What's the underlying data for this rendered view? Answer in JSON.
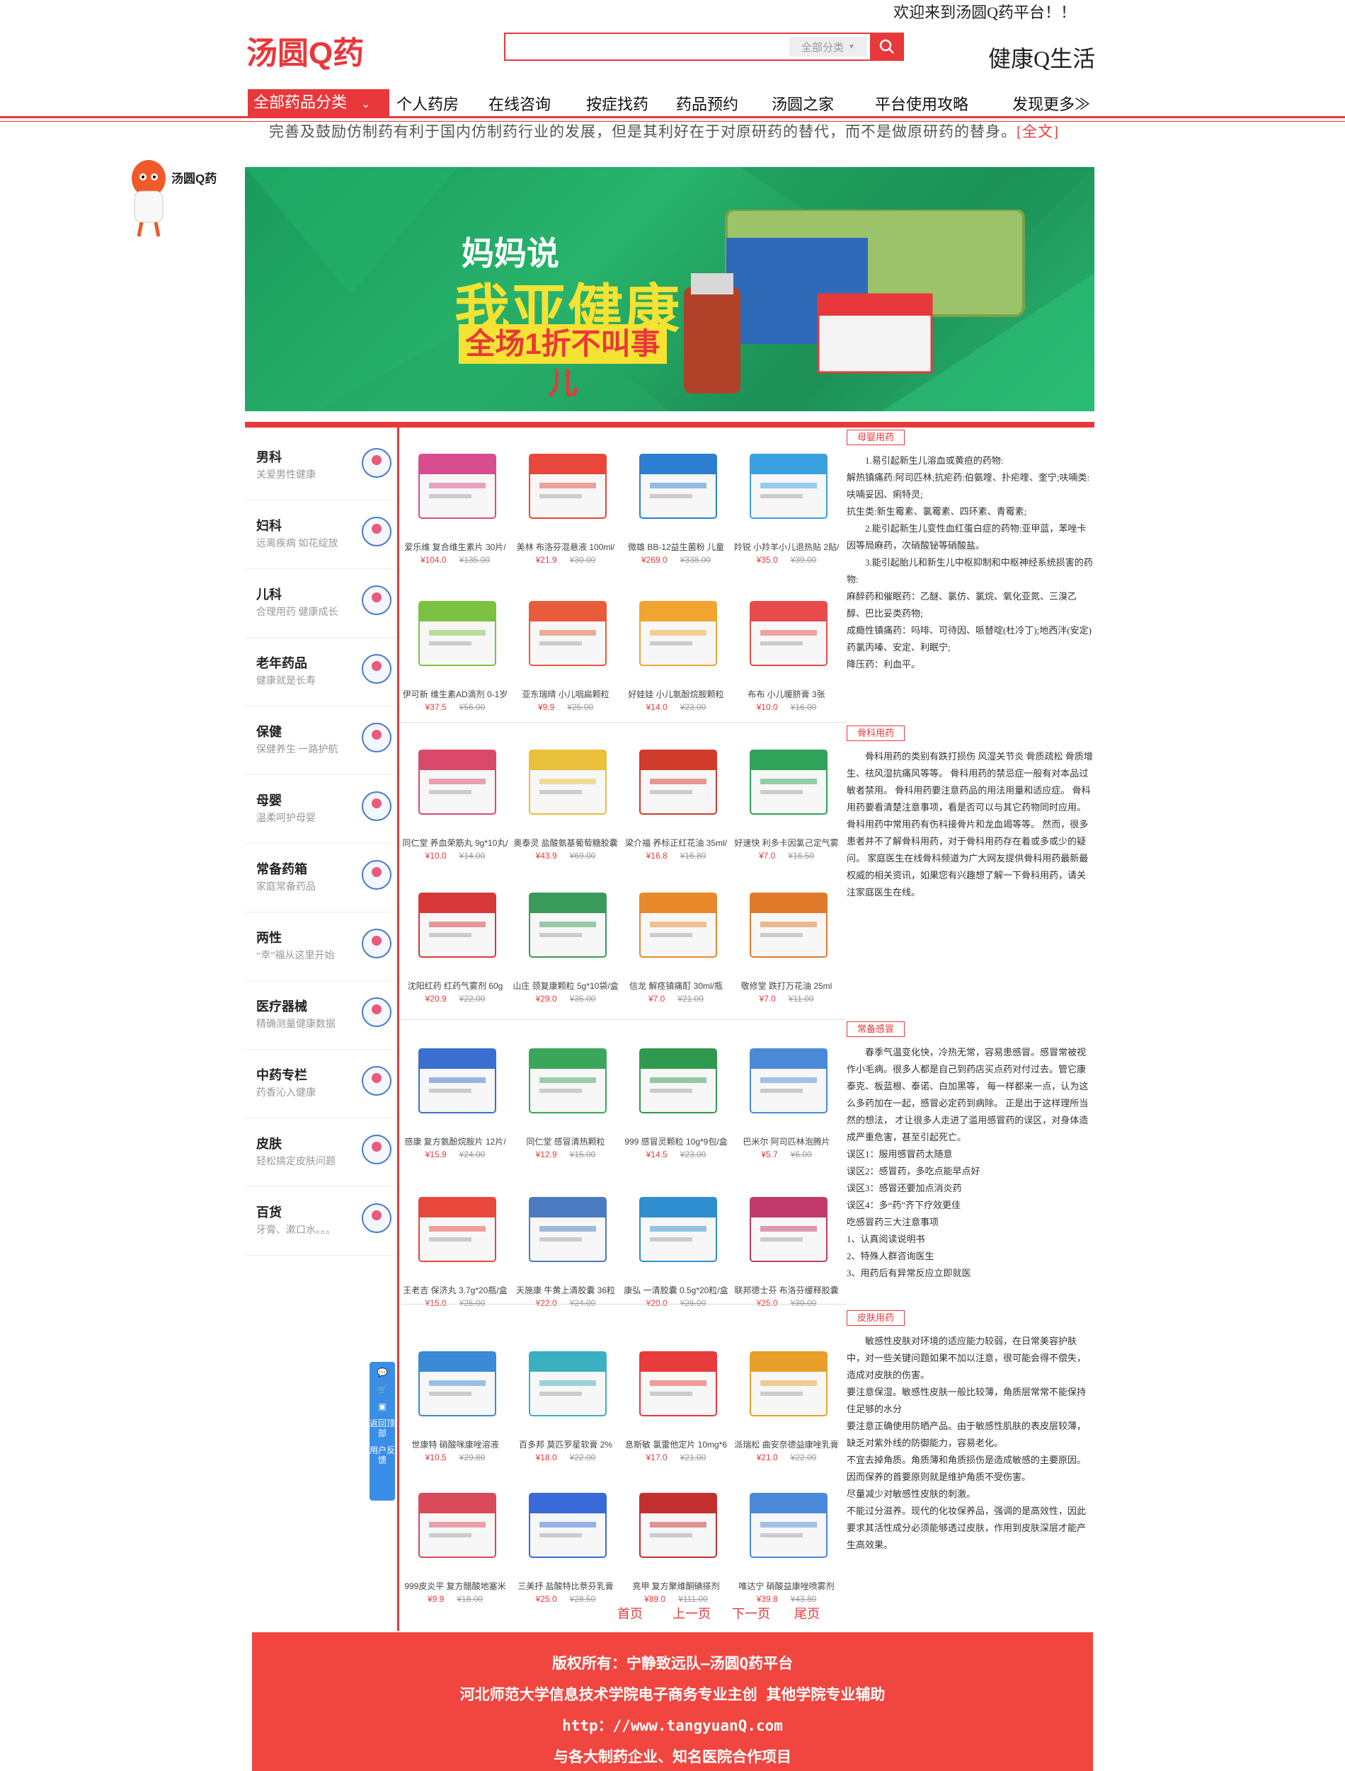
{
  "topbar": {
    "welcome": "欢迎来到汤圆Q药平台！！"
  },
  "header": {
    "logo_text": "汤圆Q药",
    "search": {
      "placeholder": "",
      "category": "全部分类"
    },
    "slogan": "健康Q生活"
  },
  "nav": {
    "all_categories": "全部药品分类",
    "items": [
      "个人药房",
      "在线咨询",
      "按症找药",
      "药品预约",
      "汤圆之家",
      "平台使用攻略",
      "发现更多≫"
    ]
  },
  "ticker": {
    "text": "完善及鼓励仿制药有利于国内仿制药行业的发展，但是其利好在于对原研药的替代，而不是做原研药的替身。",
    "link": "[全文]"
  },
  "mascot": {
    "label": "汤圆Q药"
  },
  "banner": {
    "line1": "妈妈说",
    "line2": "我亚健康",
    "line3": "全场1折不叫事儿"
  },
  "sidebar": [
    {
      "title": "男科",
      "sub": "关爱男性健康",
      "icon": "doctor-icon"
    },
    {
      "title": "妇科",
      "sub": "远离疾病 如花绽放",
      "icon": "woman-doctor-icon"
    },
    {
      "title": "儿科",
      "sub": "合理用药 健康成长",
      "icon": "child-icon"
    },
    {
      "title": "老年药品",
      "sub": "健康就是长寿",
      "icon": "elderly-icon"
    },
    {
      "title": "保健",
      "sub": "保健养生 一路护航",
      "icon": "pot-icon"
    },
    {
      "title": "母婴",
      "sub": "温柔呵护母婴",
      "icon": "mother-baby-icon"
    },
    {
      "title": "常备药箱",
      "sub": "家庭常备药品",
      "icon": "medkit-icon"
    },
    {
      "title": "两性",
      "sub": "“幸”福从这里开始",
      "icon": "gender-icon"
    },
    {
      "title": "医疗器械",
      "sub": "精确测量健康数据",
      "icon": "thermometer-icon"
    },
    {
      "title": "中药专栏",
      "sub": "药香沁入健康",
      "icon": "mortar-icon"
    },
    {
      "title": "皮肤",
      "sub": "轻松搞定皮肤问题",
      "icon": "face-icon"
    },
    {
      "title": "百货",
      "sub": "牙膏、漱口水。。。",
      "icon": "toothpaste-icon"
    }
  ],
  "products": [
    {
      "name": "爱乐维 复合维生素片 30片/",
      "price": "¥104.0",
      "old": "¥135.00",
      "color": "#d84d8f"
    },
    {
      "name": "美林 布洛芬混悬液 100ml/",
      "price": "¥21.9",
      "old": "¥30.00",
      "color": "#e8483b"
    },
    {
      "name": "微雄 BB-12益生菌粉 儿童",
      "price": "¥269.0",
      "old": "¥338.00",
      "color": "#2c7fd0"
    },
    {
      "name": "羚锐 小羚羊小儿退热贴 2贴/",
      "price": "¥35.0",
      "old": "¥39.00",
      "color": "#3aa0e0"
    },
    {
      "name": "伊可新 维生素AD滴剂 0-1岁",
      "price": "¥37.5",
      "old": "¥56.00",
      "color": "#7cc242"
    },
    {
      "name": "亚东瑞晴 小儿咽扁颗粒",
      "price": "¥9.9",
      "old": "¥25.00",
      "color": "#e85b3b"
    },
    {
      "name": "好娃娃 小儿氨酚烷胺颗粒",
      "price": "¥14.0",
      "old": "¥23.00",
      "color": "#f2a430"
    },
    {
      "name": "布布 小儿暖脐膏 3张",
      "price": "¥10.0",
      "old": "¥16.00",
      "color": "#e84b4b"
    },
    {
      "name": "同仁堂 养血荣筋丸 9g*10丸/",
      "price": "¥10.0",
      "old": "¥14.00",
      "color": "#d94a6a"
    },
    {
      "name": "奥泰灵 盐酸氨基葡萄糖胶囊",
      "price": "¥43.9",
      "old": "¥69.00",
      "color": "#e8c03b"
    },
    {
      "name": "梁介福 养标正红花油 35ml/",
      "price": "¥16.8",
      "old": "¥16.80",
      "color": "#d13b2b"
    },
    {
      "name": "好速快 利多卡因氯己定气雾",
      "price": "¥7.0",
      "old": "¥16.50",
      "color": "#2fa35a"
    },
    {
      "name": "沈阳红药 红药气雾剂 60g",
      "price": "¥20.9",
      "old": "¥22.00",
      "color": "#d7393a"
    },
    {
      "name": "山庄 颈复康颗粒 5g*10袋/盒",
      "price": "¥29.0",
      "old": "¥35.00",
      "color": "#3a9a5a"
    },
    {
      "name": "信龙 解痉镇痛酊 30ml/瓶",
      "price": "¥7.0",
      "old": "¥21.00",
      "color": "#e88a2b"
    },
    {
      "name": "敬修堂 跌打万花油 25ml",
      "price": "¥7.0",
      "old": "¥11.00",
      "color": "#e07a2b"
    },
    {
      "name": "感康 复方氨酚烷胺片 12片/",
      "price": "¥15.9",
      "old": "¥24.00",
      "color": "#3a6fd0"
    },
    {
      "name": "同仁堂 感冒清热颗粒",
      "price": "¥12.9",
      "old": "¥15.00",
      "color": "#3aa65a"
    },
    {
      "name": "999 感冒灵颗粒 10g*9包/盒",
      "price": "¥14.5",
      "old": "¥23.00",
      "color": "#2f9a4f"
    },
    {
      "name": "巴米尔 阿司匹林泡腾片",
      "price": "¥5.7",
      "old": "¥6.00",
      "color": "#4a8ad8"
    },
    {
      "name": "王老吉 保济丸 3.7g*20瓶/盒",
      "price": "¥15.0",
      "old": "¥25.00",
      "color": "#e8483b"
    },
    {
      "name": "天施康 牛黄上清胶囊 36粒",
      "price": "¥22.0",
      "old": "¥24.00",
      "color": "#4a7ac0"
    },
    {
      "name": "康弘 一清胶囊 0.5g*20粒/盒",
      "price": "¥20.0",
      "old": "¥26.00",
      "color": "#2f8ed0"
    },
    {
      "name": "联邦德士芬 布洛芬缓释胶囊",
      "price": "¥25.0",
      "old": "¥39.00",
      "color": "#c13b6a"
    },
    {
      "name": "世康特 硝酸咪康唑溶液",
      "price": "¥10.5",
      "old": "¥29.80",
      "color": "#3a8ad8"
    },
    {
      "name": "百多邦 莫匹罗星软膏 2%",
      "price": "¥18.0",
      "old": "¥22.00",
      "color": "#3ab0c0"
    },
    {
      "name": "息斯敏 氯雷他定片 10mg*6",
      "price": "¥17.0",
      "old": "¥21.00",
      "color": "#e83b3b"
    },
    {
      "name": "派瑞松 曲安奈德益康唑乳膏",
      "price": "¥21.0",
      "old": "¥22.00",
      "color": "#e8a02b"
    },
    {
      "name": "999皮炎平 复方醋酸地塞米",
      "price": "¥9.9",
      "old": "¥18.00",
      "color": "#d94a5a"
    },
    {
      "name": "三美抒 盐酸特比萘芬乳膏",
      "price": "¥25.0",
      "old": "¥28.50",
      "color": "#3a6ad8"
    },
    {
      "name": "亮甲 复方聚维酮碘搽剂",
      "price": "¥89.0",
      "old": "¥111.00",
      "color": "#c43030"
    },
    {
      "name": "唯达宁 硝酸益康唑喷雾剂",
      "price": "¥39.8",
      "old": "¥43.80",
      "color": "#4a8ad8"
    }
  ],
  "panels": [
    {
      "tag": "母婴用药",
      "paras": [
        "1.易引起新生儿溶血或黄疸的药物:\n解热镇痛药:阿司匹林;抗疟药:伯氨喹、扑疟喹、奎宁;呋喃类:呋喃妥因、痢特灵;\n抗生类:新生霉素、氯霉素、四环素、青霉素;",
        "2.能引起新生儿变性血红蛋白症的药物:亚甲蓝，苯唑卡因等局麻药，次硝酸铋等硝酸盐。",
        "3.能引起胎儿和新生儿中枢抑制和中枢神经系统损害的药物:\n麻醉药和催眠药：乙醚、氯仿、氯烷、氧化亚氮、三溴乙醇、巴比妥类药物;\n成瘾性镇痛药：吗啡、可待因、哌替啶(杜冷丁);地西泮(安定)药氯丙嗪、安定、利眠宁;\n降压药：利血平。"
      ]
    },
    {
      "tag": "骨科用药",
      "paras": [
        "骨科用药的类别有跌打损伤 风湿关节炎 骨质疏松 骨质增生、祛风湿抗痛风等等。 骨科用药的禁忌症一般有对本品过敏者禁用。 骨科用药要注意药品的用法用量和适应症。 骨科用药要看清楚注意事项，看是否可以与其它药物同时应用。 骨科用药中常用药有伤科接骨片和龙血竭等等。 然而，很多患者并不了解骨科用药，对于骨科用药存在着或多或少的疑问。 家庭医生在线骨科频道为广大网友提供骨科用药最新最权威的相关资讯，如果您有兴趣想了解一下骨科用药，请关注家庭医生在线。"
      ]
    },
    {
      "tag": "常备感冒",
      "paras": [
        "春季气温变化快，冷热无常，容易患感冒。感冒常被视作小毛病。很多人都是自己到药店买点药对付过去。管它康泰克、板蓝根、泰诺、白加黑等， 每一样都来一点，认为这么多药加在一起，感冒必定药到病除。 正是出于这样理所当然的想法， 才让很多人走进了滥用感冒药的误区，对身体造成严重危害，甚至引起死亡。\n误区1：服用感冒药太随意\n误区2：感冒药，多吃点能早点好\n误区3：感冒还要加点消炎药\n误区4：多“药”齐下疗效更佳\n吃感冒药三大注意事项\n1、认真阅读说明书\n2、特殊人群咨询医生\n3、用药后有异常反应立即就医"
      ]
    },
    {
      "tag": "皮肤用药",
      "paras": [
        "敏感性皮肤对环境的适应能力较弱，在日常美容护肤中，对一些关键问题如果不加以注意，很可能会得不偿失，造成对皮肤的伤害。\n要注意保湿。敏感性皮肤一般比较薄，角质层常常不能保持住足够的水分\n要注意正确使用防晒产品。由于敏感性肌肤的表皮层较薄，缺乏对紫外线的防御能力，容易老化。\n不宜去掉角质。角质薄和角质损伤是造成敏感的主要原因。因而保养的首要原则就是维护角质不受伤害。\n尽量减少对敏感性皮肤的刺激。\n不能过分滋养。现代的化妆保养品，强调的是高效性，因此要求其活性成分必须能够透过皮肤，作用到皮肤深层才能产生高效果。"
      ]
    }
  ],
  "pager": [
    "首页",
    "上一页",
    "下一页",
    "尾页"
  ],
  "float_bar": {
    "items": [
      "返回顶部",
      "用户反馈"
    ]
  },
  "footer": {
    "line1": "版权所有：宁静致远队—汤圆Q药平台",
    "line2": "河北师范大学信息技术学院电子商务专业主创 其他学院专业辅助",
    "line3": "http：//www.tangyuanQ.com",
    "line4": "与各大制药企业、知名医院合作项目"
  },
  "colors": {
    "accent": "#e8383b",
    "footer": "#f1463f",
    "banner": "#1fa463",
    "float": "#3a8ee6"
  }
}
